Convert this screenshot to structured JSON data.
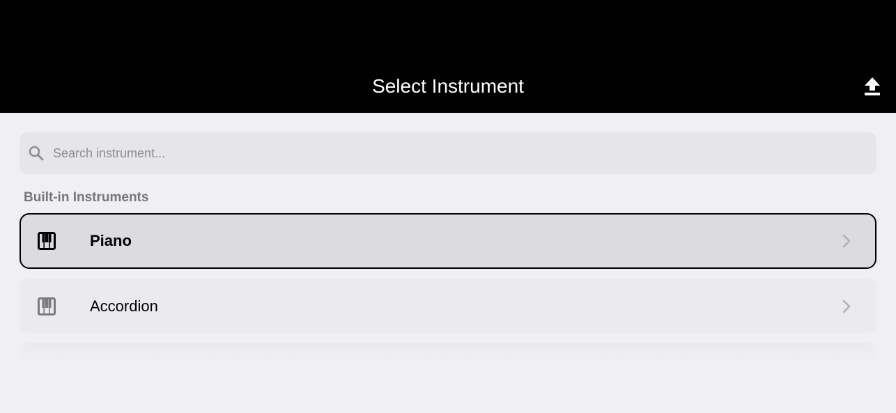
{
  "header": {
    "title": "Select Instrument",
    "upload_icon": "upload-icon"
  },
  "search": {
    "placeholder": "Search instrument...",
    "value": "",
    "icon": "search-icon"
  },
  "section": {
    "label": "Built-in Instruments"
  },
  "instruments": [
    {
      "label": "Piano",
      "icon": "piano-keys-icon",
      "selected": true
    },
    {
      "label": "Accordion",
      "icon": "piano-keys-icon",
      "selected": false
    }
  ],
  "colors": {
    "header_bg": "#000000",
    "page_bg": "#f0eff4",
    "row_bg": "#e9e8ed",
    "selected_row_bg": "#dcdbe0",
    "selected_border": "#000000",
    "muted_text": "#77767b",
    "chevron": "#b0b0b5"
  }
}
